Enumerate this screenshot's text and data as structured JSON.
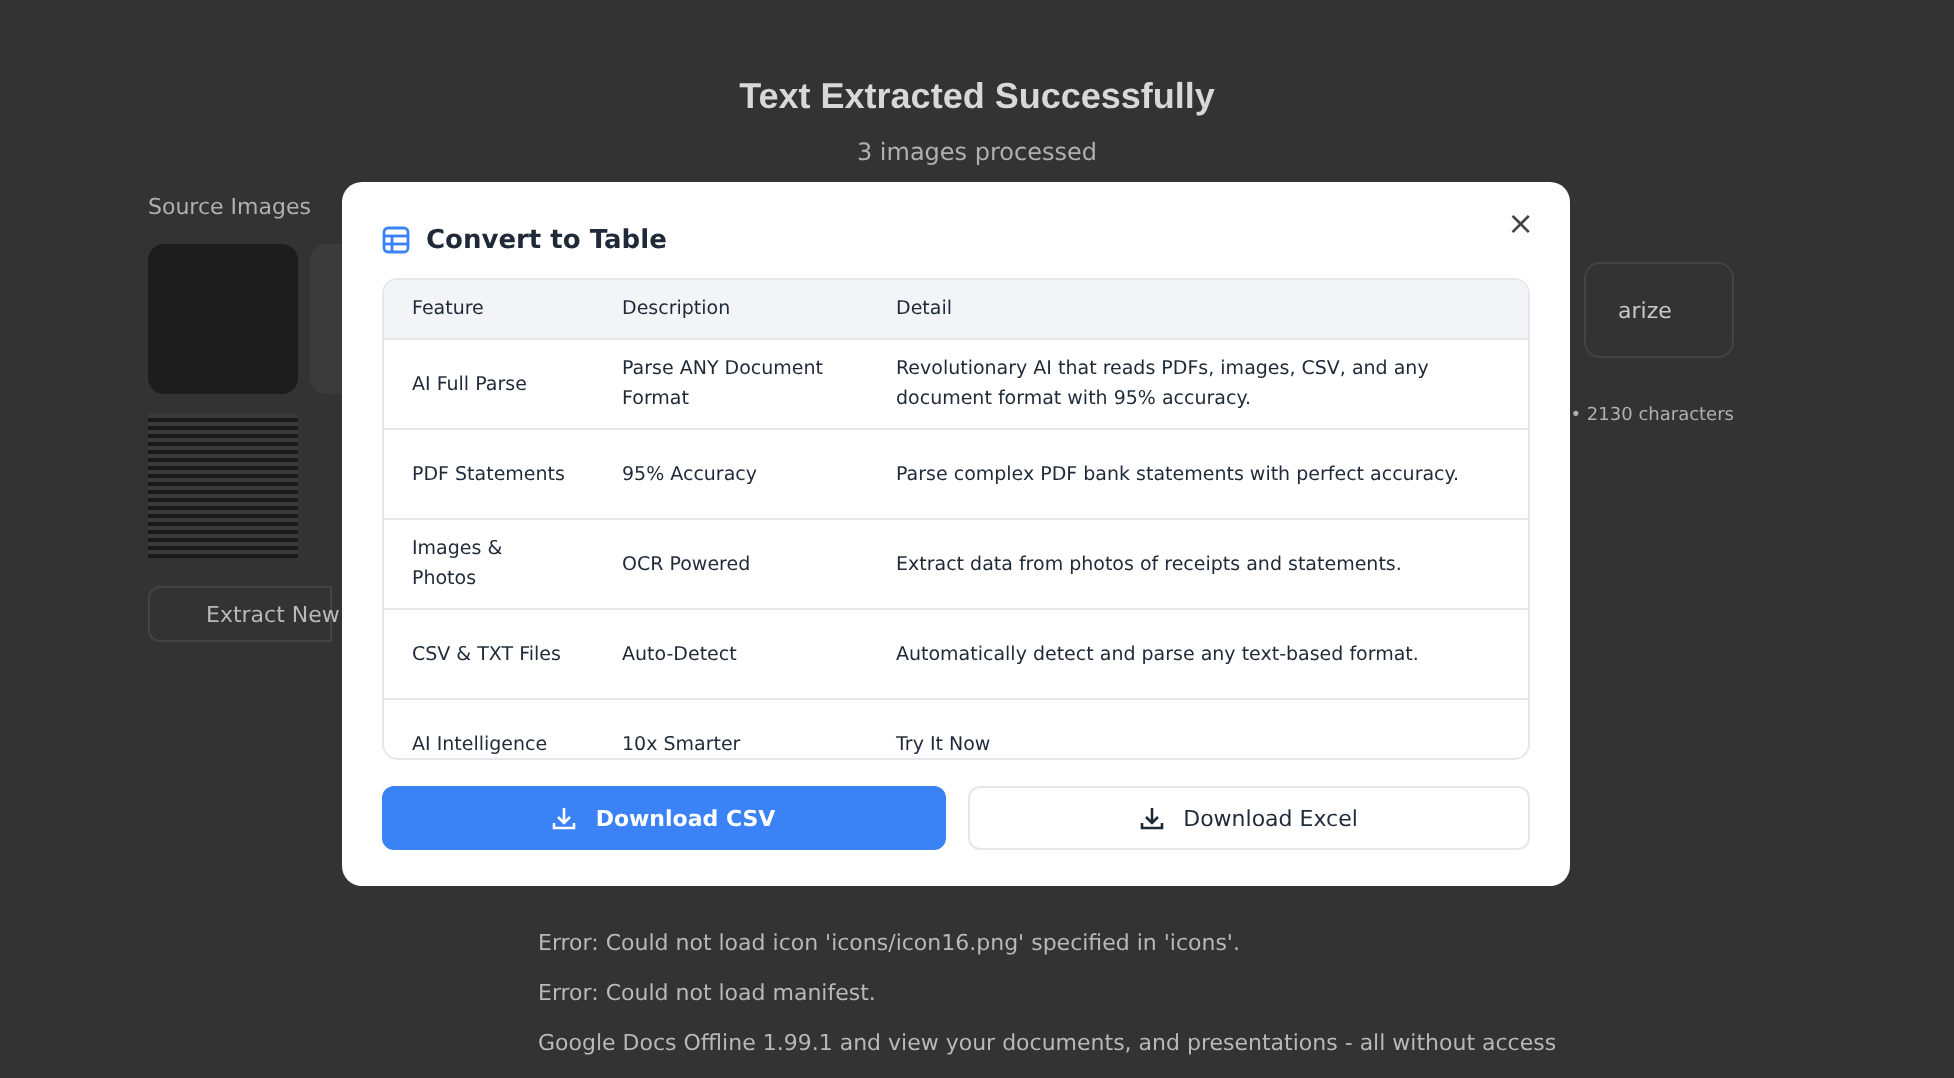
{
  "page": {
    "title": "Text Extracted Successfully",
    "subtitle": "3 images processed",
    "source_label": "Source Images",
    "extract_button": "Extract New",
    "summarize_button": "arize",
    "stats": "• 2130 characters",
    "text_lines": [
      "Error: Could not load icon 'icons/icon16.png' specified in 'icons'.",
      "Error: Could not load manifest.",
      "Google Docs Offline 1.99.1 and view your documents, and presentations - all without access"
    ]
  },
  "dialog": {
    "title": "Convert to Table",
    "close": "×",
    "table": {
      "columns": [
        "Feature",
        "Description",
        "Detail"
      ],
      "rows": [
        [
          "AI Full Parse",
          "Parse ANY Document Format",
          "Revolutionary AI that reads PDFs, images, CSV, and any document format with 95% accuracy."
        ],
        [
          "PDF Statements",
          "95% Accuracy",
          "Parse complex PDF bank statements with perfect accuracy."
        ],
        [
          "Images & Photos",
          "OCR Powered",
          "Extract data from photos of receipts and statements."
        ],
        [
          "CSV & TXT Files",
          "Auto-Detect",
          "Automatically detect and parse any text-based format."
        ],
        [
          "AI Intelligence",
          "10x Smarter",
          "Try It Now"
        ]
      ]
    },
    "buttons": [
      {
        "label": "Download CSV",
        "kind": "primary"
      },
      {
        "label": "Download Excel",
        "kind": "secondary"
      }
    ]
  }
}
